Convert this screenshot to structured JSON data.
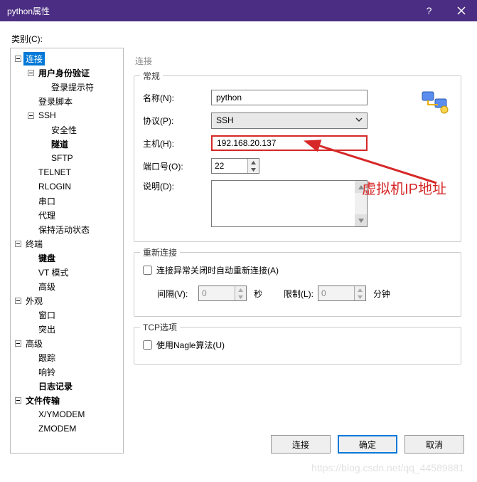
{
  "titlebar": {
    "title": "python属性"
  },
  "category_label": "类别(C):",
  "tree": {
    "nodes": [
      {
        "label": "连接",
        "indent": 0,
        "expand": true,
        "bold": false,
        "selected": true
      },
      {
        "label": "用户身份验证",
        "indent": 1,
        "expand": true,
        "bold": true
      },
      {
        "label": "登录提示符",
        "indent": 2,
        "leaf": true
      },
      {
        "label": "登录脚本",
        "indent": 1,
        "leaf": true
      },
      {
        "label": "SSH",
        "indent": 1,
        "expand": true
      },
      {
        "label": "安全性",
        "indent": 2,
        "leaf": true
      },
      {
        "label": "隧道",
        "indent": 2,
        "leaf": true,
        "bold": true
      },
      {
        "label": "SFTP",
        "indent": 2,
        "leaf": true
      },
      {
        "label": "TELNET",
        "indent": 1,
        "leaf": true
      },
      {
        "label": "RLOGIN",
        "indent": 1,
        "leaf": true
      },
      {
        "label": "串口",
        "indent": 1,
        "leaf": true
      },
      {
        "label": "代理",
        "indent": 1,
        "leaf": true
      },
      {
        "label": "保持活动状态",
        "indent": 1,
        "leaf": true
      },
      {
        "label": "终端",
        "indent": 0,
        "expand": true
      },
      {
        "label": "键盘",
        "indent": 1,
        "leaf": true,
        "bold": true
      },
      {
        "label": "VT 模式",
        "indent": 1,
        "leaf": true
      },
      {
        "label": "高级",
        "indent": 1,
        "leaf": true
      },
      {
        "label": "外观",
        "indent": 0,
        "expand": true
      },
      {
        "label": "窗口",
        "indent": 1,
        "leaf": true
      },
      {
        "label": "突出",
        "indent": 1,
        "leaf": true
      },
      {
        "label": "高级",
        "indent": 0,
        "expand": true
      },
      {
        "label": "跟踪",
        "indent": 1,
        "leaf": true
      },
      {
        "label": "响铃",
        "indent": 1,
        "leaf": true
      },
      {
        "label": "日志记录",
        "indent": 1,
        "leaf": true,
        "bold": true
      },
      {
        "label": "文件传输",
        "indent": 0,
        "expand": true,
        "bold": true
      },
      {
        "label": "X/YMODEM",
        "indent": 1,
        "leaf": true
      },
      {
        "label": "ZMODEM",
        "indent": 1,
        "leaf": true
      }
    ]
  },
  "content": {
    "header": "连接",
    "general": {
      "title": "常规",
      "name_label": "名称(N):",
      "name_value": "python",
      "protocol_label": "协议(P):",
      "protocol_value": "SSH",
      "host_label": "主机(H):",
      "host_value": "192.168.20.137",
      "port_label": "端口号(O):",
      "port_value": "22",
      "desc_label": "说明(D):",
      "desc_value": ""
    },
    "annotation": "虚拟机IP地址",
    "reconnect": {
      "title": "重新连接",
      "checkbox_label": "连接异常关闭时自动重新连接(A)",
      "interval_label": "间隔(V):",
      "interval_value": "0",
      "interval_unit": "秒",
      "limit_label": "限制(L):",
      "limit_value": "0",
      "limit_unit": "分钟"
    },
    "tcp": {
      "title": "TCP选项",
      "nagle_label": "使用Nagle算法(U)"
    }
  },
  "buttons": {
    "connect": "连接",
    "ok": "确定",
    "cancel": "取消"
  },
  "watermark": "https://blog.csdn.net/qq_44589881"
}
